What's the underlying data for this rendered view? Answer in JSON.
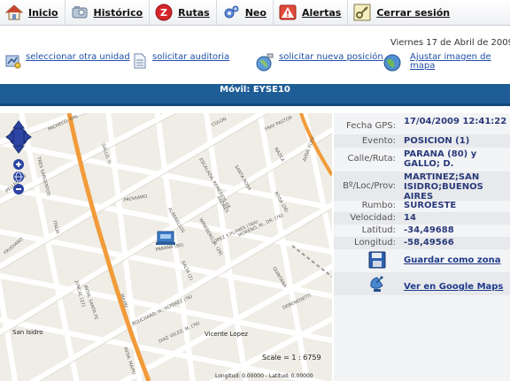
{
  "nav": {
    "items": [
      {
        "label": "Inicio",
        "icon": "home-icon"
      },
      {
        "label": "Histórico",
        "icon": "history-icon"
      },
      {
        "label": "Rutas",
        "icon": "routes-icon"
      },
      {
        "label": "Neo",
        "icon": "neo-icon"
      },
      {
        "label": "Alertas",
        "icon": "alert-icon"
      },
      {
        "label": "Cerrar sesión",
        "icon": "logout-icon"
      }
    ]
  },
  "header": {
    "date": "Viernes 17 de Abril de 2009"
  },
  "actions": {
    "select_unit": "seleccionar otra unidad",
    "request_audit": "solicitar auditoria",
    "request_position": "solicitar nueva posición",
    "fit_map_line1": "Ajustar imagen de",
    "fit_map_line2": "mapa"
  },
  "mobile": {
    "title": "Móvil: EYSE10"
  },
  "details": {
    "fecha_label": "Fecha GPS:",
    "fecha_value": "17/04/2009 12:41:22",
    "evento_label": "Evento:",
    "evento_value": "POSICION (1)",
    "calle_label": "Calle/Ruta:",
    "calle_value": "PARANA (80) y GALLO; D.",
    "loc_label": "Bº/Loc/Prov:",
    "loc_value": "MARTINEZ;SAN ISIDRO;BUENOS AIRES",
    "rumbo_label": "Rumbo:",
    "rumbo_value": "SUROESTE",
    "velocidad_label": "Velocidad:",
    "velocidad_value": "14",
    "latitud_label": "Latitud:",
    "latitud_value": "-34,49688",
    "longitud_label": "Longitud:",
    "longitud_value": "-58,49566",
    "save_zone": "Guardar como zona",
    "google_maps": "Ver en Google Maps"
  },
  "map": {
    "scale": "Scale = 1 : 6759",
    "coords": "Longitud: 0.00000 - Latitud: 0.00000",
    "places": [
      "San Isidro",
      "Vicente Lopez"
    ],
    "streets": [
      "PACHECO, GRL",
      "TRES SARGENTOS",
      "AVDA. SANTA FE",
      "GALLO, D.",
      "COLON",
      "ESCALADA, REMEDIOS DE",
      "SANTA ROSA",
      "ANDRES",
      "FRAY PASTOR",
      "NAZCA",
      "AVDA. FLEU",
      "PROVIAMO",
      "ALBERELLOS",
      "WINEBERG, H. (28)",
      "LOPEZ Y PLANES (76A)",
      "MORENO, M., DR. (76)",
      "PARANA (80)",
      "SALTA (2)",
      "ROSA (28)",
      "ITALIA",
      "PELLEGRINI",
      "FRUDIANO",
      "JUNCAL (27)",
      "QUINTANA",
      "DEBENEDETTI",
      "BOUCHARD, H., ALFEREZ (76)",
      "DIAZ VELEZ, M. (76)",
      "AVDA. MAIPU",
      "MAIPU"
    ]
  }
}
